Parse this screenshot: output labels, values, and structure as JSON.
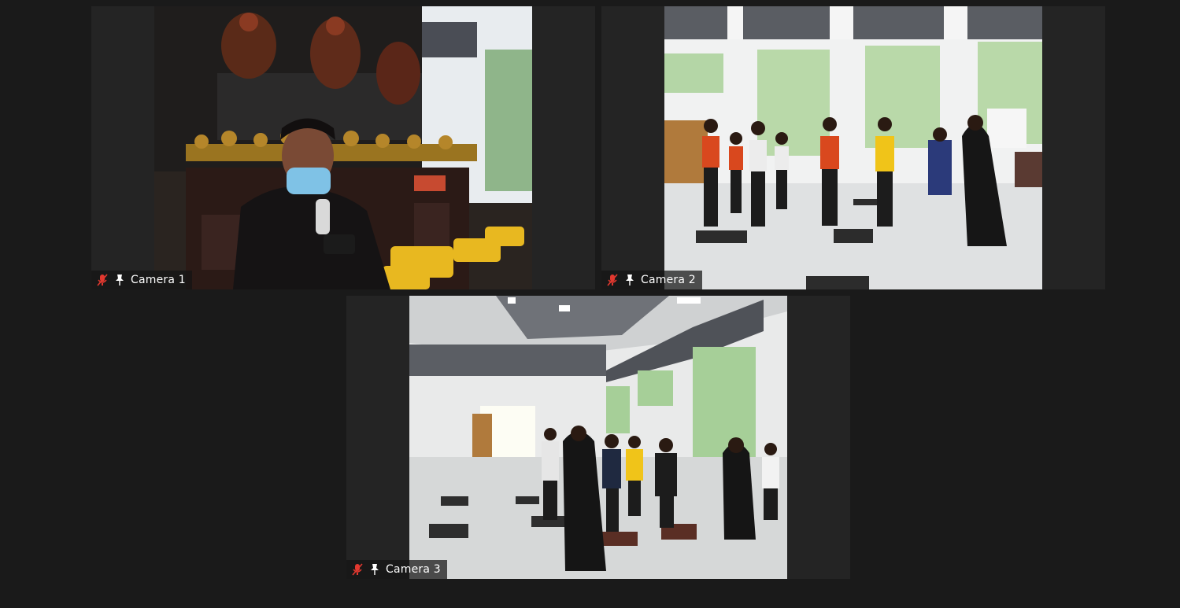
{
  "participants": [
    {
      "name": "Camera 1",
      "muted": true,
      "pinned": true
    },
    {
      "name": "Camera 2",
      "muted": true,
      "pinned": true
    },
    {
      "name": "Camera 3",
      "muted": true,
      "pinned": true
    }
  ],
  "icons": {
    "muted": "microphone-muted-icon",
    "pinned": "pin-icon"
  },
  "colors": {
    "background": "#1a1a1a",
    "tile_background": "#242424",
    "muted_icon": "#e2382f",
    "label_text": "#ffffff"
  }
}
